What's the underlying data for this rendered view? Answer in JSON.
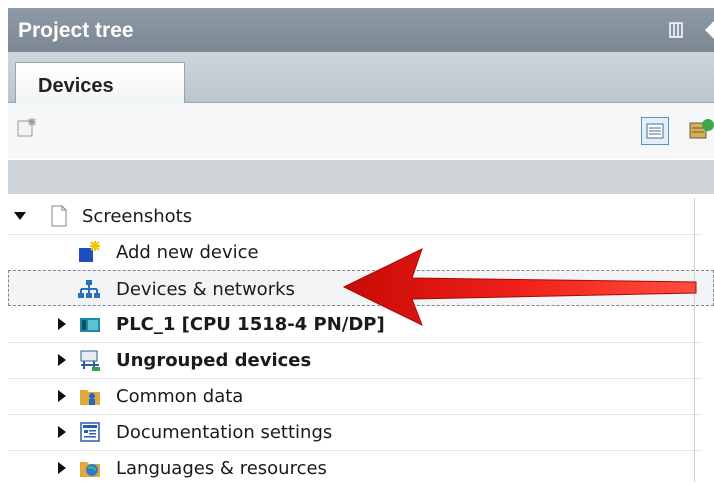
{
  "panel": {
    "title": "Project tree",
    "tab_label": "Devices"
  },
  "tree": {
    "root": {
      "label": "Screenshots",
      "expanded": true
    },
    "items": [
      {
        "label": "Add new device",
        "icon": "add-device-icon",
        "bold": false,
        "expandable": false
      },
      {
        "label": "Devices & networks",
        "icon": "network-icon",
        "bold": false,
        "expandable": false,
        "selected": true
      },
      {
        "label": "PLC_1 [CPU 1518-4 PN/DP]",
        "icon": "plc-icon",
        "bold": true,
        "expandable": true
      },
      {
        "label": "Ungrouped devices",
        "icon": "ungrouped-devices-icon",
        "bold": true,
        "expandable": true
      },
      {
        "label": "Common data",
        "icon": "common-data-icon",
        "bold": false,
        "expandable": true
      },
      {
        "label": "Documentation settings",
        "icon": "documentation-icon",
        "bold": false,
        "expandable": true
      },
      {
        "label": "Languages & resources",
        "icon": "languages-icon",
        "bold": false,
        "expandable": true
      }
    ]
  },
  "colors": {
    "title_bar": "#8e9ba6",
    "annotation_arrow": "#e8120c"
  }
}
